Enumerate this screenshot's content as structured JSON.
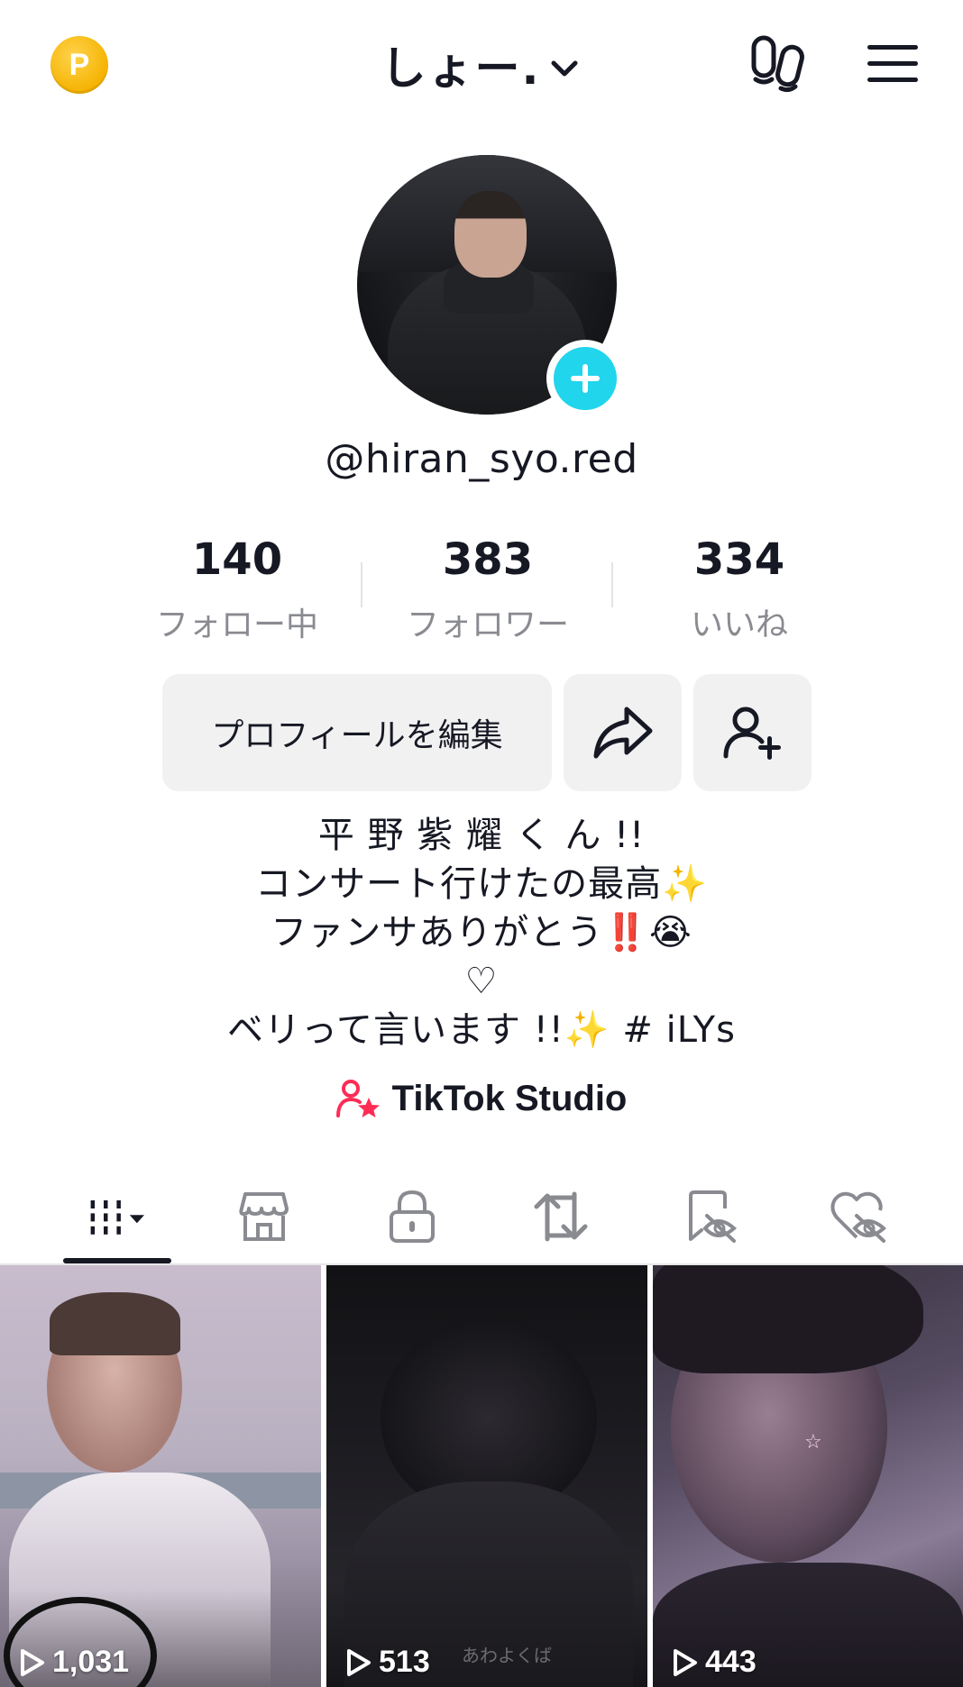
{
  "header": {
    "coin_letter": "P",
    "title": "しょー.",
    "icons": [
      "coin-icon",
      "chevron-down-icon",
      "footprint-icon",
      "menu-icon"
    ]
  },
  "profile": {
    "username": "@hiran_syo.red",
    "add_icon": "plus-icon"
  },
  "stats": [
    {
      "value": "140",
      "label": "フォロー中"
    },
    {
      "value": "383",
      "label": "フォロワー"
    },
    {
      "value": "334",
      "label": "いいね"
    }
  ],
  "actions": {
    "edit_label": "プロフィールを編集",
    "share_icon": "share-arrow-icon",
    "add_friend_icon": "add-friend-icon"
  },
  "bio": {
    "lines": [
      "平 野 紫 耀 く ん !!",
      "コンサート行けたの最高✨",
      "ファンサありがとう‼️😭",
      "♡",
      "ベリって言います !!✨  # iLYs"
    ]
  },
  "studio": {
    "label": "TikTok Studio"
  },
  "tabs": [
    {
      "name": "videos",
      "icon": "grid-icon"
    },
    {
      "name": "shop",
      "icon": "shop-icon"
    },
    {
      "name": "private",
      "icon": "lock-icon"
    },
    {
      "name": "reposts",
      "icon": "repost-icon"
    },
    {
      "name": "favorites",
      "icon": "bookmark-hidden-icon"
    },
    {
      "name": "liked",
      "icon": "heart-hidden-icon"
    }
  ],
  "videos": [
    {
      "views": "1,031"
    },
    {
      "views": "513",
      "caption": "あわよくば"
    },
    {
      "views": "443"
    }
  ],
  "colors": {
    "accent_cyan": "#20d5ec",
    "studio_pink": "#fe2c55",
    "coin_gold": "#f5b301",
    "text": "#161823",
    "muted": "#8a8b91"
  }
}
